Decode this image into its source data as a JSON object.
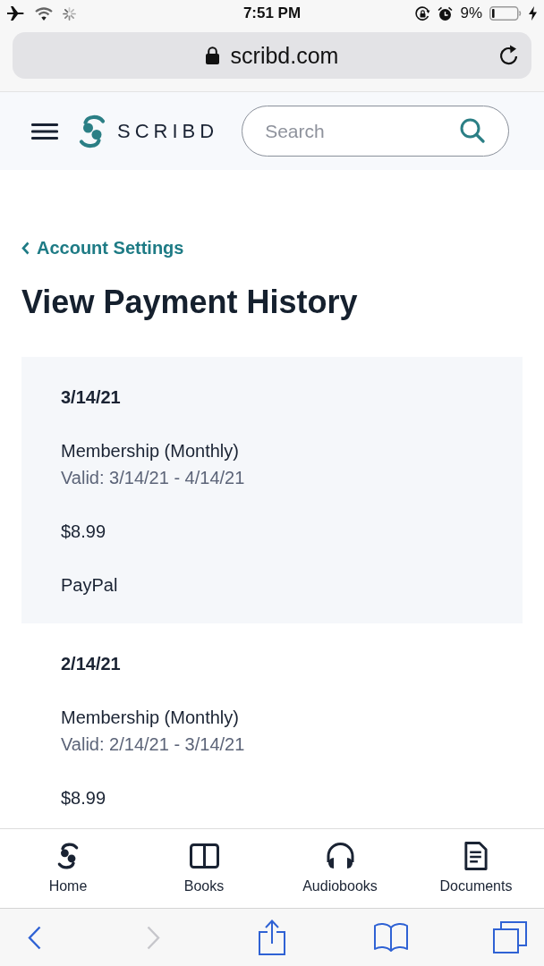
{
  "status_bar": {
    "time": "7:51 PM",
    "battery": "9%"
  },
  "address_bar": {
    "url": "scribd.com"
  },
  "header": {
    "logo": "SCRIBD",
    "search": {
      "placeholder": "Search"
    }
  },
  "back_link": "Account Settings",
  "title": "View Payment History",
  "payments": [
    {
      "date": "3/14/21",
      "plan": "Membership (Monthly)",
      "validity": "Valid: 3/14/21 - 4/14/21",
      "amount": "$8.99",
      "method": "PayPal"
    },
    {
      "date": "2/14/21",
      "plan": "Membership (Monthly)",
      "validity": "Valid: 2/14/21 - 3/14/21",
      "amount": "$8.99"
    }
  ],
  "bottom_nav": [
    {
      "label": "Home",
      "kind": "home",
      "selected": false
    },
    {
      "label": "Books",
      "kind": "books",
      "selected": false
    },
    {
      "label": "Audiobooks",
      "kind": "audiobooks",
      "selected": false
    },
    {
      "label": "Documents",
      "kind": "documents",
      "selected": false
    }
  ],
  "browser_toolbar": [
    {
      "kind": "back",
      "disabled": false
    },
    {
      "kind": "forward",
      "disabled": true
    },
    {
      "kind": "share",
      "disabled": false
    },
    {
      "kind": "bookmarks",
      "disabled": false
    },
    {
      "kind": "tabs",
      "disabled": false
    }
  ]
}
